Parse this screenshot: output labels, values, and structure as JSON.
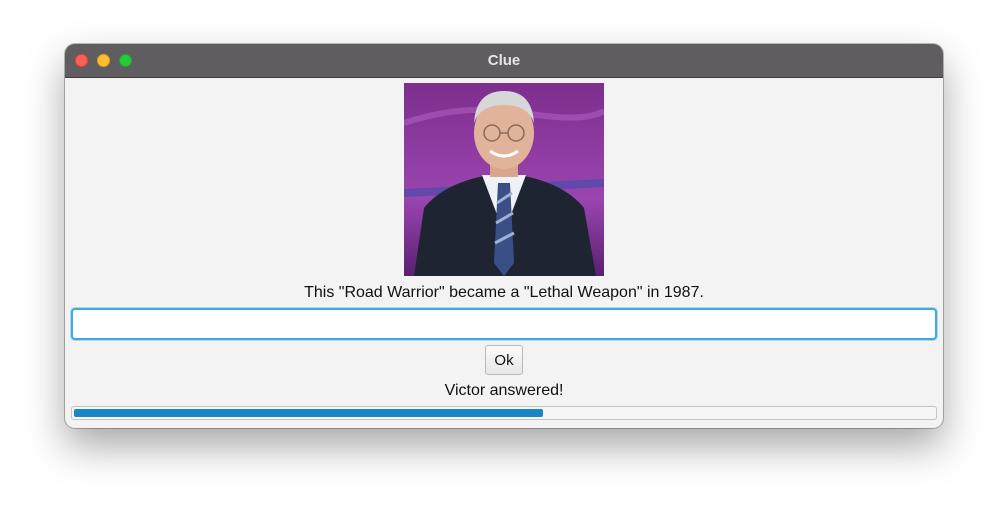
{
  "window": {
    "title": "Clue"
  },
  "clue": {
    "text": "This \"Road Warrior\" became a \"Lethal Weapon\" in 1987."
  },
  "answer_field": {
    "value": "",
    "placeholder": ""
  },
  "ok_button": {
    "label": "Ok"
  },
  "status": {
    "text": "Victor answered!"
  },
  "progress": {
    "fraction": 0.545
  },
  "colors": {
    "titlebar": "#5f5d60",
    "focus_ring": "#3ea8e2",
    "progress_fill": "#1a86c5",
    "photo_background": "#8a3a9c"
  }
}
